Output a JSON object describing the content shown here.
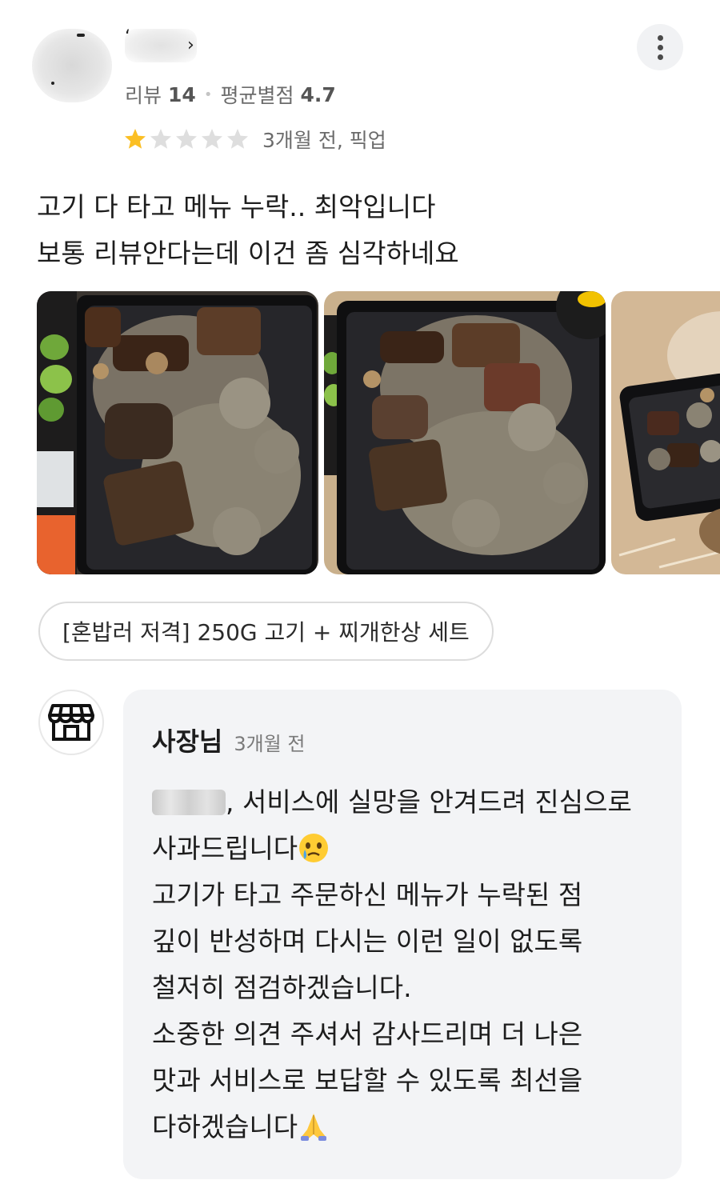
{
  "review": {
    "stats": {
      "review_label": "리뷰",
      "review_count": "14",
      "separator": "•",
      "avg_label": "평균별점",
      "avg_value": "4.7"
    },
    "rating": {
      "stars": 1,
      "max_stars": 5,
      "meta_text": "3개월 전, 픽업"
    },
    "text_lines": [
      "고기 다 타고 메뉴 누락.. 최악입니다",
      "보통 리뷰안다는데 이건 좀 심각하네요"
    ],
    "photos": [
      "food-photo-1",
      "food-photo-2",
      "food-photo-3"
    ],
    "menu_chip": "[혼밥러 저격] 250G 고기 + 찌개한상 세트"
  },
  "reply": {
    "author": "사장님",
    "time": "3개월 전",
    "line1_suffix": ", 서비스에 실망을 안겨드려 진심으로",
    "line2": "사과드립니다",
    "line3": "고기가 타고 주문하신 메뉴가 누락된 점",
    "line4": "깊이 반성하며 다시는 이런 일이 없도록",
    "line5": "철저히 점검하겠습니다.",
    "line6": "소중한 의견 주셔서 감사드리며 더 나은",
    "line7": "맛과 서비스로 보답할 수 있도록 최선을",
    "line8": "다하겠습니다"
  },
  "icons": {
    "more": "more-vertical-icon",
    "store": "store-icon",
    "star": "star-icon",
    "tear_emoji": "face-holding-back-tears-emoji",
    "pray_emoji": "folded-hands-emoji"
  },
  "colors": {
    "star_filled": "#fbbf24",
    "star_empty": "#dedede",
    "reply_bg": "#f3f4f6"
  }
}
